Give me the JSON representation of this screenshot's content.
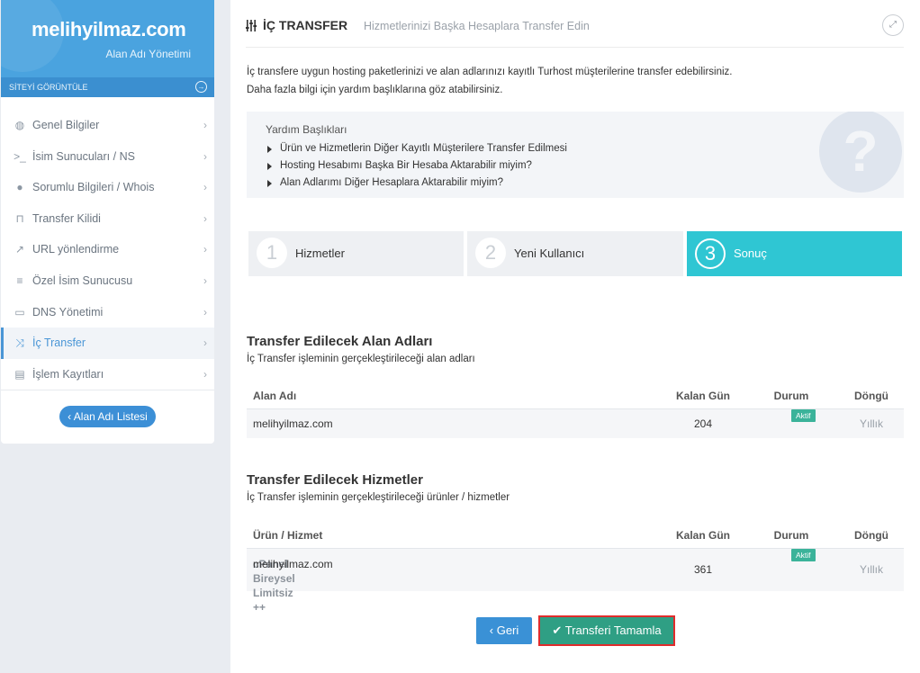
{
  "sidebar": {
    "site_name": "melihyilmaz.com",
    "subtitle": "Alan Adı Yönetimi",
    "view_site": "SİTEYİ GÖRÜNTÜLE",
    "items": [
      {
        "label": "Genel Bilgiler",
        "icon": "globe-icon"
      },
      {
        "label": "İsim Sunucuları / NS",
        "icon": "terminal-icon"
      },
      {
        "label": "Sorumlu Bilgileri / Whois",
        "icon": "user-icon"
      },
      {
        "label": "Transfer Kilidi",
        "icon": "unlock-icon"
      },
      {
        "label": "URL yönlendirme",
        "icon": "external-link-icon"
      },
      {
        "label": "Özel İsim Sunucusu",
        "icon": "list-icon"
      },
      {
        "label": "DNS Yönetimi",
        "icon": "laptop-icon"
      },
      {
        "label": "İç Transfer",
        "icon": "shuffle-icon"
      },
      {
        "label": "İşlem Kayıtları",
        "icon": "table-list-icon"
      }
    ],
    "active_index": 7,
    "domain_list_button": "Alan Adı Listesi"
  },
  "header": {
    "title": "İÇ TRANSFER",
    "subtitle": "Hizmetlerinizi Başka Hesaplara Transfer Edin"
  },
  "intro": {
    "line1": "İç transfere uygun hosting paketlerinizi ve alan adlarınızı kayıtlı Turhost müşterilerine transfer edebilirsiniz.",
    "line2": "Daha fazla bilgi için yardım başlıklarına göz atabilirsiniz."
  },
  "help": {
    "heading": "Yardım Başlıkları",
    "items": [
      "Ürün ve Hizmetlerin Diğer Kayıtlı Müşterilere Transfer Edilmesi",
      "Hosting Hesabımı Başka Bir Hesaba Aktarabilir miyim?",
      "Alan Adlarımı Diğer Hesaplara Aktarabilir miyim?"
    ]
  },
  "steps": [
    {
      "num": "1",
      "label": "Hizmetler"
    },
    {
      "num": "2",
      "label": "Yeni Kullanıcı"
    },
    {
      "num": "3",
      "label": "Sonuç"
    }
  ],
  "domains_section": {
    "title": "Transfer Edilecek Alan Adları",
    "subtitle": "İç Transfer işleminin gerçekleştirileceği alan adları",
    "columns": {
      "name": "Alan Adı",
      "days": "Kalan Gün",
      "status": "Durum",
      "cycle": "Döngü"
    },
    "rows": [
      {
        "name": "melihyilmaz.com",
        "days": "204",
        "status": "Aktif",
        "cycle": "Yıllık"
      }
    ]
  },
  "services_section": {
    "title": "Transfer Edilecek Hizmetler",
    "subtitle": "İç Transfer işleminin gerçekleştirileceği ürünler / hizmetler",
    "columns": {
      "name": "Ürün / Hizmet",
      "days": "Kalan Gün",
      "status": "Durum",
      "cycle": "Döngü"
    },
    "rows": [
      {
        "product": "cPanel Bireysel Limitsiz ++",
        "domain": "melihyilmaz.com",
        "days": "361",
        "status": "Aktif",
        "cycle": "Yıllık"
      }
    ]
  },
  "actions": {
    "back": "Geri",
    "finish": "Transferi Tamamla"
  },
  "colors": {
    "brand_blue": "#4aa3df",
    "active_step": "#2fc6d3",
    "status_green": "#3bb39a",
    "finish_button": "#2f9f84",
    "highlight_border": "#e02c2c"
  }
}
